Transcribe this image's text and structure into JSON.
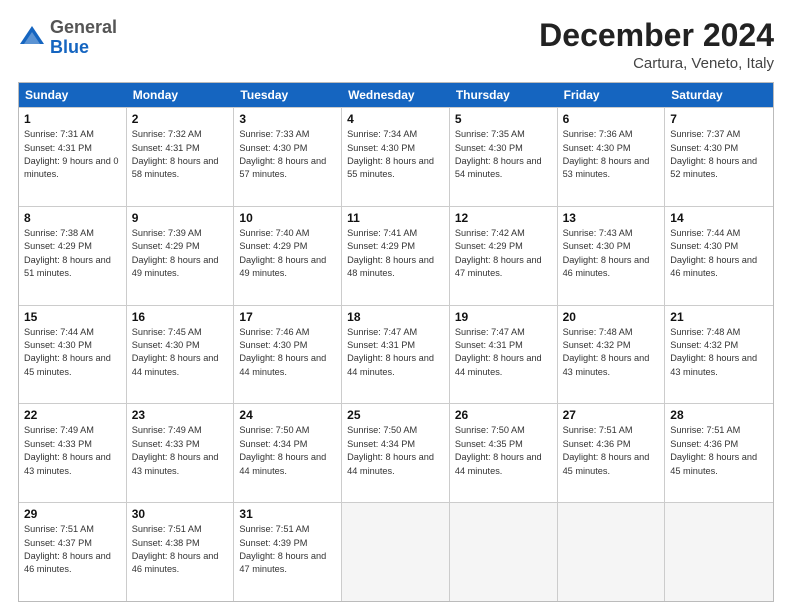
{
  "header": {
    "logo_general": "General",
    "logo_blue": "Blue",
    "title": "December 2024",
    "subtitle": "Cartura, Veneto, Italy"
  },
  "weekdays": [
    "Sunday",
    "Monday",
    "Tuesday",
    "Wednesday",
    "Thursday",
    "Friday",
    "Saturday"
  ],
  "weeks": [
    [
      {
        "day": "1",
        "sunrise": "Sunrise: 7:31 AM",
        "sunset": "Sunset: 4:31 PM",
        "daylight": "Daylight: 9 hours and 0 minutes."
      },
      {
        "day": "2",
        "sunrise": "Sunrise: 7:32 AM",
        "sunset": "Sunset: 4:31 PM",
        "daylight": "Daylight: 8 hours and 58 minutes."
      },
      {
        "day": "3",
        "sunrise": "Sunrise: 7:33 AM",
        "sunset": "Sunset: 4:30 PM",
        "daylight": "Daylight: 8 hours and 57 minutes."
      },
      {
        "day": "4",
        "sunrise": "Sunrise: 7:34 AM",
        "sunset": "Sunset: 4:30 PM",
        "daylight": "Daylight: 8 hours and 55 minutes."
      },
      {
        "day": "5",
        "sunrise": "Sunrise: 7:35 AM",
        "sunset": "Sunset: 4:30 PM",
        "daylight": "Daylight: 8 hours and 54 minutes."
      },
      {
        "day": "6",
        "sunrise": "Sunrise: 7:36 AM",
        "sunset": "Sunset: 4:30 PM",
        "daylight": "Daylight: 8 hours and 53 minutes."
      },
      {
        "day": "7",
        "sunrise": "Sunrise: 7:37 AM",
        "sunset": "Sunset: 4:30 PM",
        "daylight": "Daylight: 8 hours and 52 minutes."
      }
    ],
    [
      {
        "day": "8",
        "sunrise": "Sunrise: 7:38 AM",
        "sunset": "Sunset: 4:29 PM",
        "daylight": "Daylight: 8 hours and 51 minutes."
      },
      {
        "day": "9",
        "sunrise": "Sunrise: 7:39 AM",
        "sunset": "Sunset: 4:29 PM",
        "daylight": "Daylight: 8 hours and 49 minutes."
      },
      {
        "day": "10",
        "sunrise": "Sunrise: 7:40 AM",
        "sunset": "Sunset: 4:29 PM",
        "daylight": "Daylight: 8 hours and 49 minutes."
      },
      {
        "day": "11",
        "sunrise": "Sunrise: 7:41 AM",
        "sunset": "Sunset: 4:29 PM",
        "daylight": "Daylight: 8 hours and 48 minutes."
      },
      {
        "day": "12",
        "sunrise": "Sunrise: 7:42 AM",
        "sunset": "Sunset: 4:29 PM",
        "daylight": "Daylight: 8 hours and 47 minutes."
      },
      {
        "day": "13",
        "sunrise": "Sunrise: 7:43 AM",
        "sunset": "Sunset: 4:30 PM",
        "daylight": "Daylight: 8 hours and 46 minutes."
      },
      {
        "day": "14",
        "sunrise": "Sunrise: 7:44 AM",
        "sunset": "Sunset: 4:30 PM",
        "daylight": "Daylight: 8 hours and 46 minutes."
      }
    ],
    [
      {
        "day": "15",
        "sunrise": "Sunrise: 7:44 AM",
        "sunset": "Sunset: 4:30 PM",
        "daylight": "Daylight: 8 hours and 45 minutes."
      },
      {
        "day": "16",
        "sunrise": "Sunrise: 7:45 AM",
        "sunset": "Sunset: 4:30 PM",
        "daylight": "Daylight: 8 hours and 44 minutes."
      },
      {
        "day": "17",
        "sunrise": "Sunrise: 7:46 AM",
        "sunset": "Sunset: 4:30 PM",
        "daylight": "Daylight: 8 hours and 44 minutes."
      },
      {
        "day": "18",
        "sunrise": "Sunrise: 7:47 AM",
        "sunset": "Sunset: 4:31 PM",
        "daylight": "Daylight: 8 hours and 44 minutes."
      },
      {
        "day": "19",
        "sunrise": "Sunrise: 7:47 AM",
        "sunset": "Sunset: 4:31 PM",
        "daylight": "Daylight: 8 hours and 44 minutes."
      },
      {
        "day": "20",
        "sunrise": "Sunrise: 7:48 AM",
        "sunset": "Sunset: 4:32 PM",
        "daylight": "Daylight: 8 hours and 43 minutes."
      },
      {
        "day": "21",
        "sunrise": "Sunrise: 7:48 AM",
        "sunset": "Sunset: 4:32 PM",
        "daylight": "Daylight: 8 hours and 43 minutes."
      }
    ],
    [
      {
        "day": "22",
        "sunrise": "Sunrise: 7:49 AM",
        "sunset": "Sunset: 4:33 PM",
        "daylight": "Daylight: 8 hours and 43 minutes."
      },
      {
        "day": "23",
        "sunrise": "Sunrise: 7:49 AM",
        "sunset": "Sunset: 4:33 PM",
        "daylight": "Daylight: 8 hours and 43 minutes."
      },
      {
        "day": "24",
        "sunrise": "Sunrise: 7:50 AM",
        "sunset": "Sunset: 4:34 PM",
        "daylight": "Daylight: 8 hours and 44 minutes."
      },
      {
        "day": "25",
        "sunrise": "Sunrise: 7:50 AM",
        "sunset": "Sunset: 4:34 PM",
        "daylight": "Daylight: 8 hours and 44 minutes."
      },
      {
        "day": "26",
        "sunrise": "Sunrise: 7:50 AM",
        "sunset": "Sunset: 4:35 PM",
        "daylight": "Daylight: 8 hours and 44 minutes."
      },
      {
        "day": "27",
        "sunrise": "Sunrise: 7:51 AM",
        "sunset": "Sunset: 4:36 PM",
        "daylight": "Daylight: 8 hours and 45 minutes."
      },
      {
        "day": "28",
        "sunrise": "Sunrise: 7:51 AM",
        "sunset": "Sunset: 4:36 PM",
        "daylight": "Daylight: 8 hours and 45 minutes."
      }
    ],
    [
      {
        "day": "29",
        "sunrise": "Sunrise: 7:51 AM",
        "sunset": "Sunset: 4:37 PM",
        "daylight": "Daylight: 8 hours and 46 minutes."
      },
      {
        "day": "30",
        "sunrise": "Sunrise: 7:51 AM",
        "sunset": "Sunset: 4:38 PM",
        "daylight": "Daylight: 8 hours and 46 minutes."
      },
      {
        "day": "31",
        "sunrise": "Sunrise: 7:51 AM",
        "sunset": "Sunset: 4:39 PM",
        "daylight": "Daylight: 8 hours and 47 minutes."
      },
      null,
      null,
      null,
      null
    ]
  ]
}
